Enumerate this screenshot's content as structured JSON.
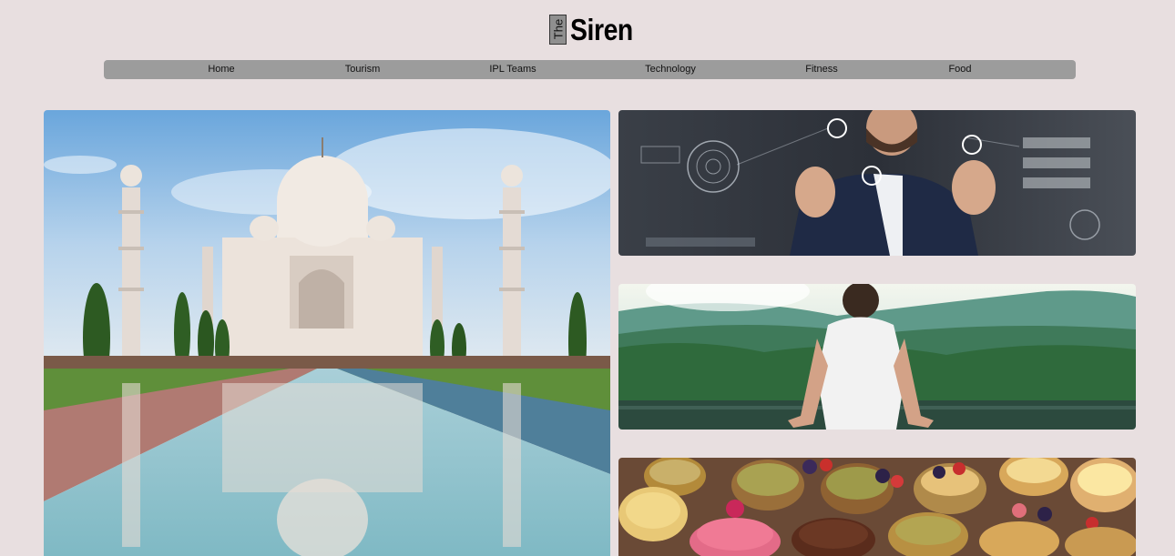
{
  "logo": {
    "prefix": "The",
    "name": "Siren"
  },
  "nav": {
    "items": [
      {
        "label": "Home"
      },
      {
        "label": "Tourism"
      },
      {
        "label": "IPL Teams"
      },
      {
        "label": "Technology"
      },
      {
        "label": "Fitness"
      },
      {
        "label": "Food"
      }
    ]
  },
  "cards": {
    "tourism": {
      "icon": "taj-mahal-photo"
    },
    "technology": {
      "icon": "tech-interface-photo"
    },
    "fitness": {
      "icon": "meditation-photo"
    },
    "food": {
      "icon": "pastries-photo"
    }
  },
  "colors": {
    "background": "#e8dfe0",
    "nav_background": "#9c9c9c"
  }
}
